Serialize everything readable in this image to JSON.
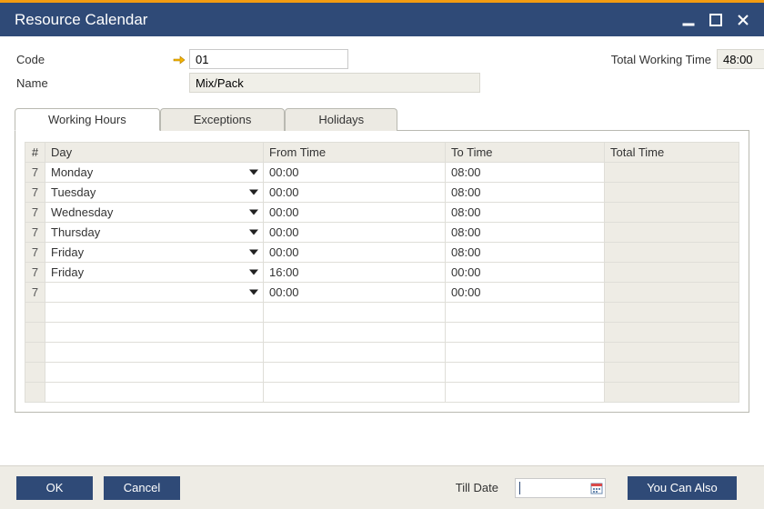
{
  "window": {
    "title": "Resource Calendar"
  },
  "fields": {
    "code_label": "Code",
    "code_value": "01",
    "name_label": "Name",
    "name_value": "Mix/Pack",
    "twt_label": "Total Working Time",
    "twt_value": "48:00"
  },
  "tabs": {
    "working_hours": "Working Hours",
    "exceptions": "Exceptions",
    "holidays": "Holidays"
  },
  "grid": {
    "col_num": "#",
    "col_day": "Day",
    "col_from": "From Time",
    "col_to": "To Time",
    "col_total": "Total Time",
    "rows": [
      {
        "num": "7",
        "day": "Monday",
        "from": "00:00",
        "to": "08:00",
        "total": ""
      },
      {
        "num": "7",
        "day": "Tuesday",
        "from": "00:00",
        "to": "08:00",
        "total": ""
      },
      {
        "num": "7",
        "day": "Wednesday",
        "from": "00:00",
        "to": "08:00",
        "total": ""
      },
      {
        "num": "7",
        "day": "Thursday",
        "from": "00:00",
        "to": "08:00",
        "total": ""
      },
      {
        "num": "7",
        "day": "Friday",
        "from": "00:00",
        "to": "08:00",
        "total": ""
      },
      {
        "num": "7",
        "day": "Friday",
        "from": "16:00",
        "to": "00:00",
        "total": ""
      },
      {
        "num": "7",
        "day": "",
        "from": "00:00",
        "to": "00:00",
        "total": ""
      },
      {
        "num": "",
        "day": "",
        "from": "",
        "to": "",
        "total": ""
      },
      {
        "num": "",
        "day": "",
        "from": "",
        "to": "",
        "total": ""
      },
      {
        "num": "",
        "day": "",
        "from": "",
        "to": "",
        "total": ""
      },
      {
        "num": "",
        "day": "",
        "from": "",
        "to": "",
        "total": ""
      },
      {
        "num": "",
        "day": "",
        "from": "",
        "to": "",
        "total": ""
      }
    ]
  },
  "footer": {
    "ok": "OK",
    "cancel": "Cancel",
    "till_date": "Till Date",
    "till_date_value": "",
    "you_can_also": "You Can Also"
  },
  "icons": {
    "link_arrow": "link-arrow-icon",
    "dropdown": "chevron-down-icon",
    "calendar": "calendar-icon",
    "minimize": "minimize-icon",
    "maximize": "maximize-icon",
    "close": "close-icon"
  }
}
